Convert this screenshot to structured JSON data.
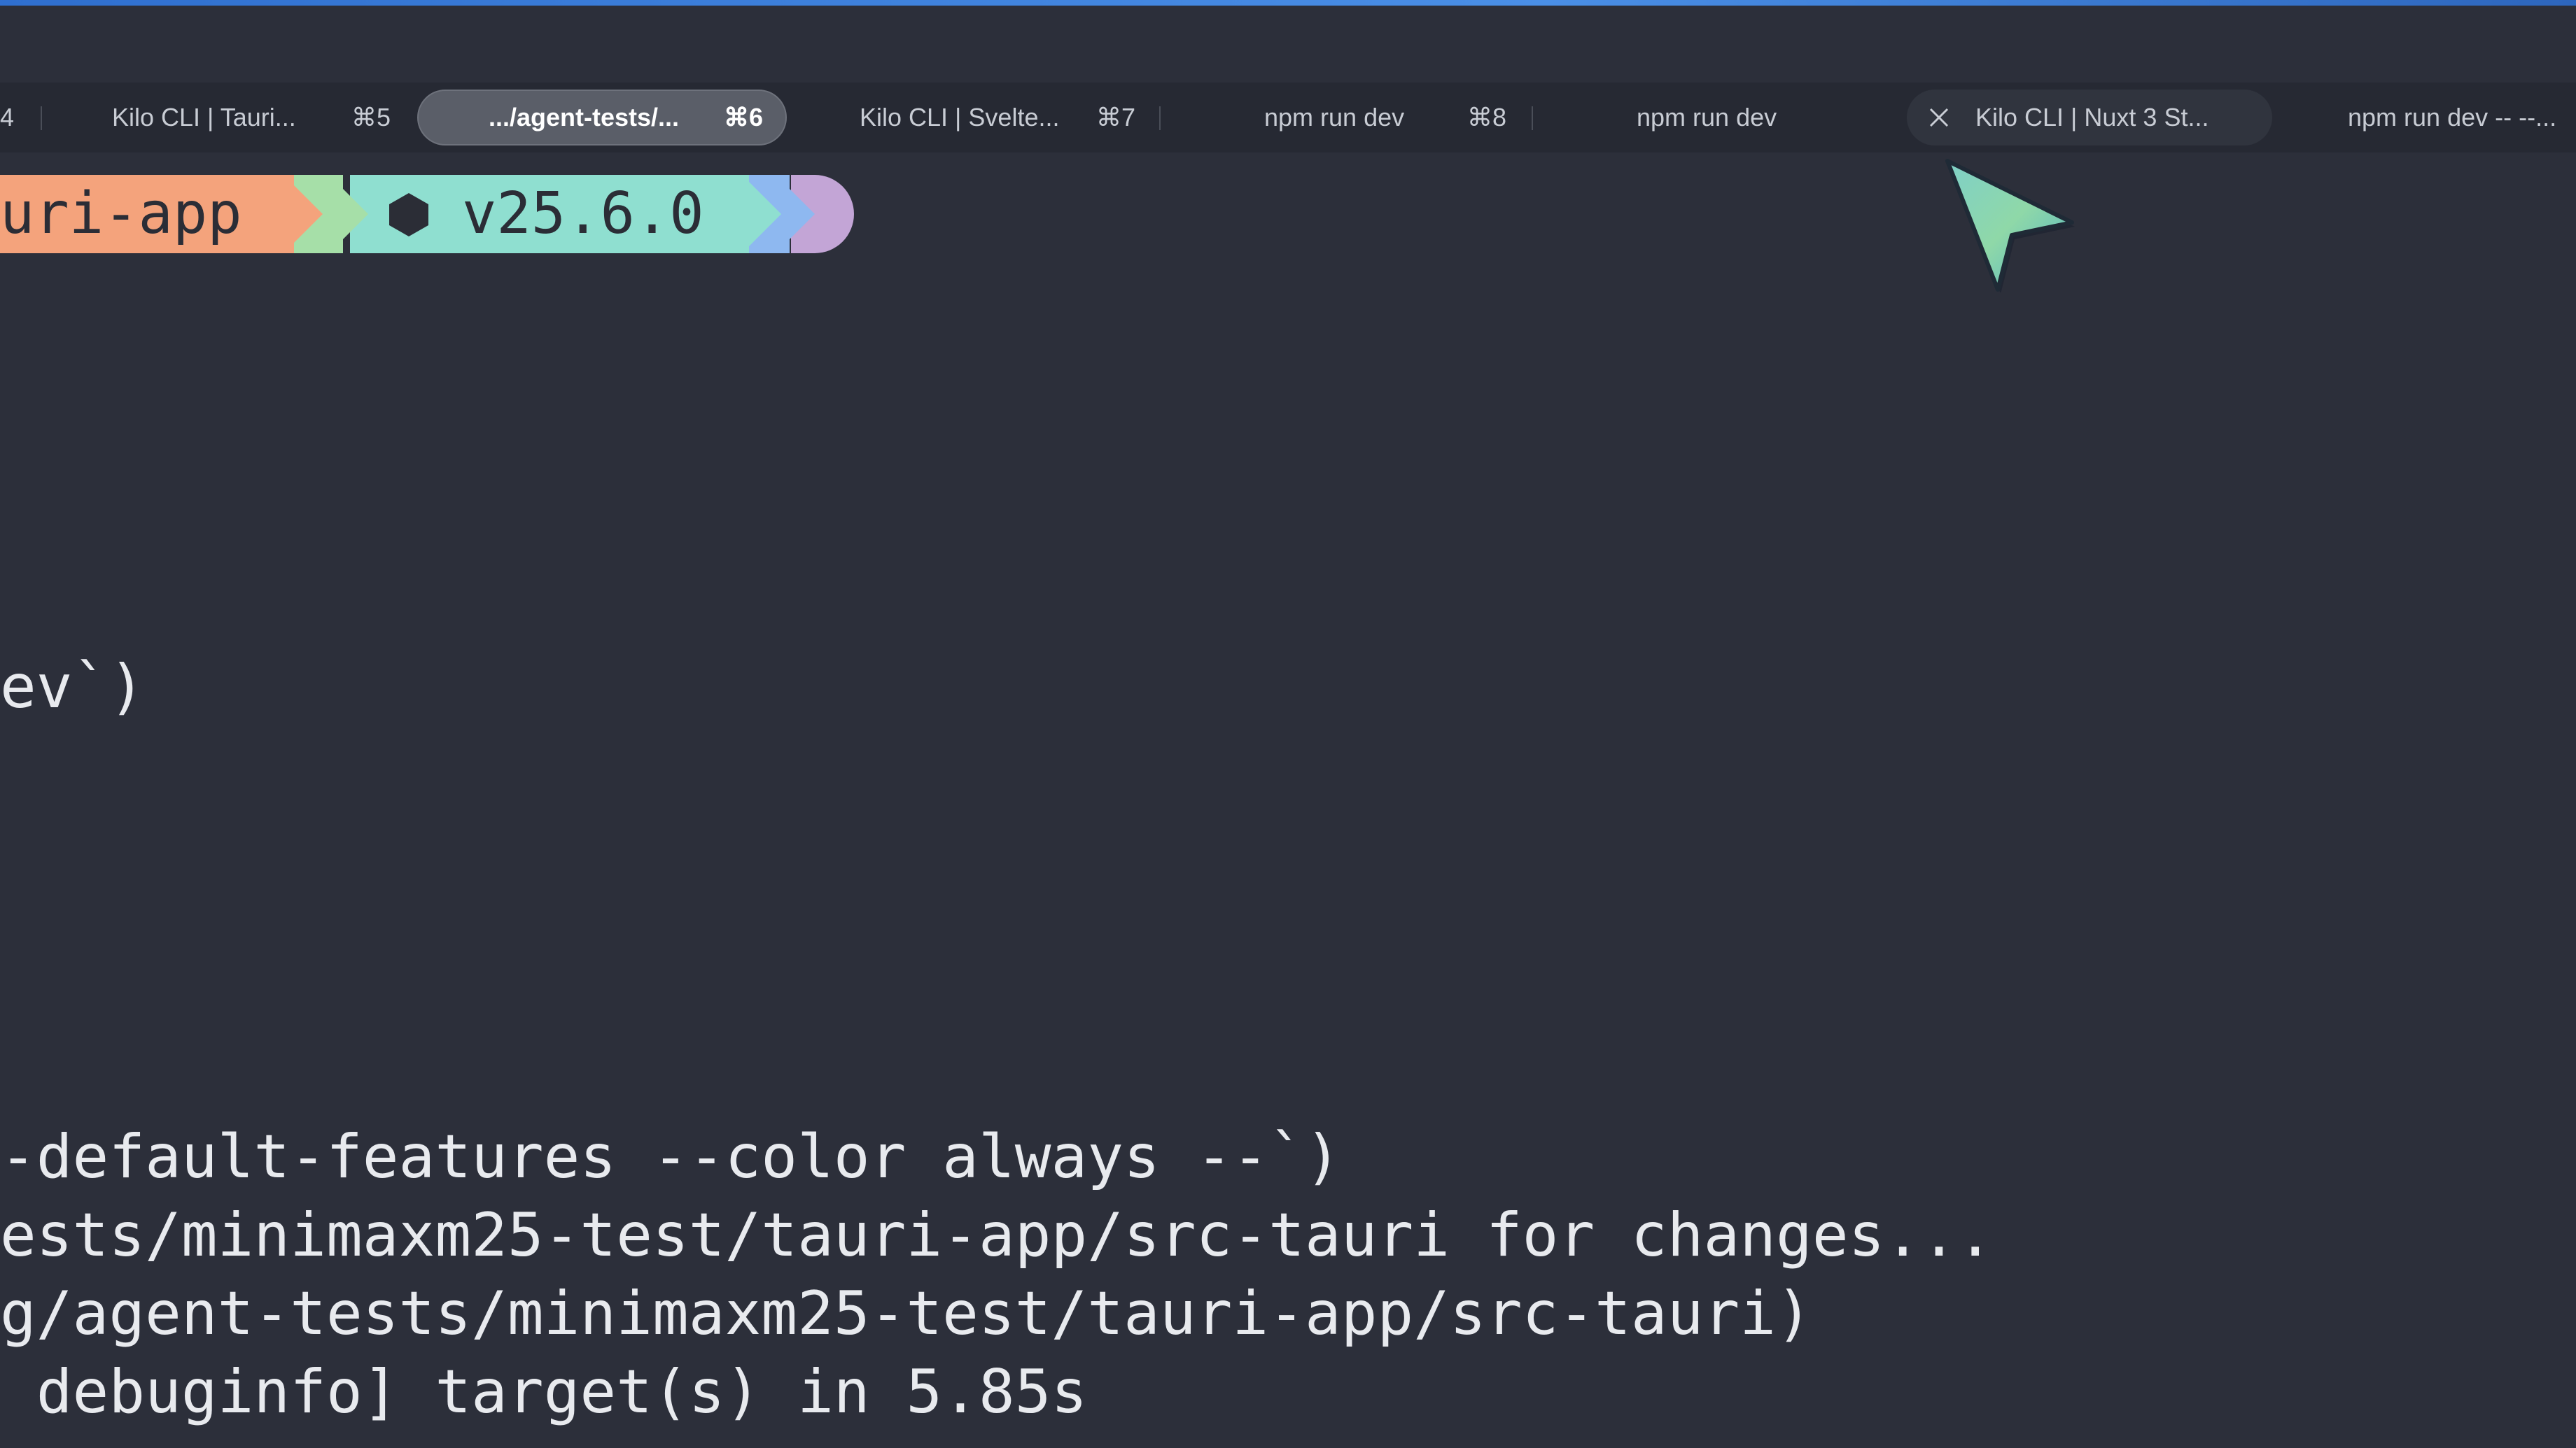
{
  "window": {
    "accent_color": "#3a7be0",
    "background": "#2c2f3a"
  },
  "tabs": [
    {
      "label": "4",
      "shortcut": ""
    },
    {
      "label": "Kilo CLI | Tauri...",
      "shortcut": "⌘5"
    },
    {
      "label": ".../agent-tests/...",
      "shortcut": "⌘6",
      "active": true
    },
    {
      "label": "Kilo CLI | Svelte...",
      "shortcut": "⌘7"
    },
    {
      "label": "npm run dev",
      "shortcut": "⌘8"
    },
    {
      "label": "npm run dev",
      "shortcut": ""
    },
    {
      "label": "Kilo CLI | Nuxt 3 St...",
      "shortcut": "",
      "hovered": true
    },
    {
      "label": "npm run dev -- --...",
      "shortcut": ""
    }
  ],
  "prompt": {
    "directory": "uri-app",
    "node_version": "v25.6.0",
    "colors": {
      "directory": "#f4a37c",
      "node": "#8fdfd0",
      "separator_green": "#a6dfa8",
      "separator_blue": "#8eb8f0",
      "end_purple": "#c3a5d6"
    }
  },
  "terminal": {
    "lines": [
      "ev`)",
      "-default-features --color always --`)",
      "ests/minimaxm25-test/tauri-app/src-tauri for changes...",
      "g/agent-tests/minimaxm25-test/tauri-app/src-tauri)",
      " debuginfo] target(s) in 5.85s"
    ]
  },
  "icons": {
    "tab_close": "close-icon",
    "node": "hexagon-icon",
    "pointer": "cursor-arrow-icon"
  }
}
